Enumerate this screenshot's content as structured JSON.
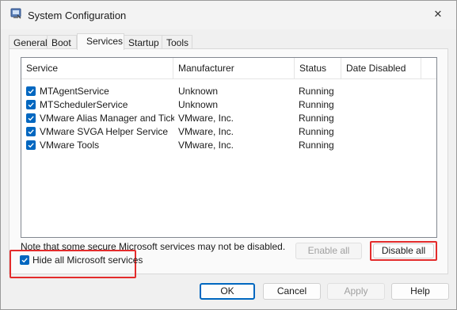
{
  "window": {
    "title": "System Configuration",
    "close_glyph": "✕"
  },
  "tabs": [
    {
      "label": "General",
      "active": false
    },
    {
      "label": "Boot",
      "active": false
    },
    {
      "label": "Services",
      "active": true
    },
    {
      "label": "Startup",
      "active": false
    },
    {
      "label": "Tools",
      "active": false
    }
  ],
  "services": {
    "columns": {
      "service": "Service",
      "manufacturer": "Manufacturer",
      "status": "Status",
      "date_disabled": "Date Disabled"
    },
    "rows": [
      {
        "checked": true,
        "service": "MTAgentService",
        "manufacturer": "Unknown",
        "status": "Running",
        "date_disabled": ""
      },
      {
        "checked": true,
        "service": "MTSchedulerService",
        "manufacturer": "Unknown",
        "status": "Running",
        "date_disabled": ""
      },
      {
        "checked": true,
        "service": "VMware Alias Manager and Ticke...",
        "manufacturer": "VMware, Inc.",
        "status": "Running",
        "date_disabled": ""
      },
      {
        "checked": true,
        "service": "VMware SVGA Helper Service",
        "manufacturer": "VMware, Inc.",
        "status": "Running",
        "date_disabled": ""
      },
      {
        "checked": true,
        "service": "VMware Tools",
        "manufacturer": "VMware, Inc.",
        "status": "Running",
        "date_disabled": ""
      }
    ],
    "note": "Note that some secure Microsoft services may not be disabled.",
    "enable_all": "Enable all",
    "disable_all": "Disable all",
    "hide_microsoft_label": "Hide all Microsoft services",
    "hide_microsoft_checked": true
  },
  "footer": {
    "ok": "OK",
    "cancel": "Cancel",
    "apply": "Apply",
    "help": "Help"
  },
  "colors": {
    "accent": "#0067c0",
    "highlight": "#e32c2c"
  }
}
